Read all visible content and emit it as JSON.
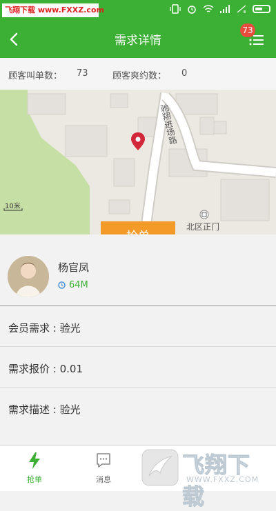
{
  "statusbar": {
    "watermark": "飞翔下载 www.FXXZ.com"
  },
  "header": {
    "title": "需求详情",
    "badge_count": "73"
  },
  "stats": {
    "calls_label": "顾客叫单数：",
    "calls_value": "73",
    "breaks_label": "顾客爽约数：",
    "breaks_value": "0"
  },
  "map": {
    "road_label": "驰翔进场路",
    "poi_label": "北区正门",
    "scale_label": "10米"
  },
  "action": {
    "grab_label": "抢单"
  },
  "profile": {
    "name": "杨官凤",
    "distance": "64M"
  },
  "details": [
    {
      "label": "会员需求 : 验光"
    },
    {
      "label": "需求报价 : 0.01"
    },
    {
      "label": "需求描述 : 验光"
    }
  ],
  "tabs": [
    {
      "label": "抢单"
    },
    {
      "label": "消息"
    }
  ],
  "watermark2": {
    "text": "飞翔下载",
    "url": "WWW.FXXZ.COM"
  },
  "colors": {
    "primary": "#3cb034",
    "accent": "#f39a28",
    "badge": "#e74c3c"
  }
}
